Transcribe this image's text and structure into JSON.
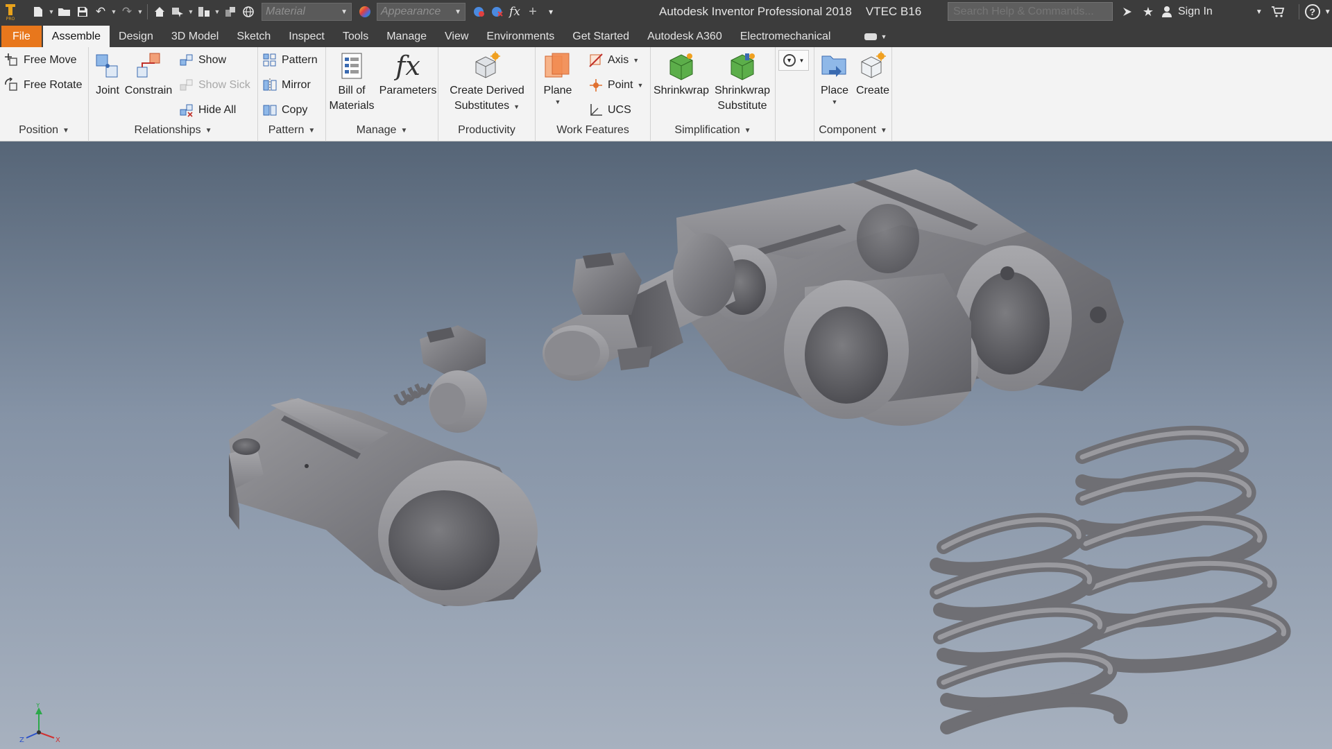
{
  "quick_access": {
    "material_placeholder": "Material",
    "appearance_placeholder": "Appearance"
  },
  "title": {
    "app": "Autodesk Inventor Professional 2018",
    "document": "VTEC B16"
  },
  "search": {
    "placeholder": "Search Help & Commands..."
  },
  "account": {
    "sign_in": "Sign In"
  },
  "tabs": [
    {
      "label": "File"
    },
    {
      "label": "Assemble"
    },
    {
      "label": "Design"
    },
    {
      "label": "3D Model"
    },
    {
      "label": "Sketch"
    },
    {
      "label": "Inspect"
    },
    {
      "label": "Tools"
    },
    {
      "label": "Manage"
    },
    {
      "label": "View"
    },
    {
      "label": "Environments"
    },
    {
      "label": "Get Started"
    },
    {
      "label": "Autodesk A360"
    },
    {
      "label": "Electromechanical"
    }
  ],
  "ribbon": {
    "position": {
      "label": "Position",
      "free_move": "Free Move",
      "free_rotate": "Free Rotate"
    },
    "relationships": {
      "label": "Relationships",
      "joint": "Joint",
      "constrain": "Constrain",
      "show": "Show",
      "show_sick": "Show Sick",
      "hide_all": "Hide All"
    },
    "pattern": {
      "label": "Pattern",
      "pattern": "Pattern",
      "mirror": "Mirror",
      "copy": "Copy"
    },
    "manage": {
      "label": "Manage",
      "bom_line1": "Bill of",
      "bom_line2": "Materials",
      "parameters": "Parameters"
    },
    "productivity": {
      "label": "Productivity",
      "line1": "Create Derived",
      "line2": "Substitutes"
    },
    "work_features": {
      "label": "Work Features",
      "plane": "Plane",
      "axis": "Axis",
      "point": "Point",
      "ucs": "UCS"
    },
    "simplification": {
      "label": "Simplification",
      "shrinkwrap": "Shrinkwrap",
      "sub_line1": "Shrinkwrap",
      "sub_line2": "Substitute"
    },
    "component": {
      "label": "Component",
      "place": "Place",
      "create": "Create"
    }
  },
  "triad": {
    "x": "X",
    "y": "Y",
    "z": "Z"
  },
  "colors": {
    "file_tab": "#e8771c",
    "titlebar": "#3c3c3c",
    "part_gray": "#7a7a7e"
  }
}
